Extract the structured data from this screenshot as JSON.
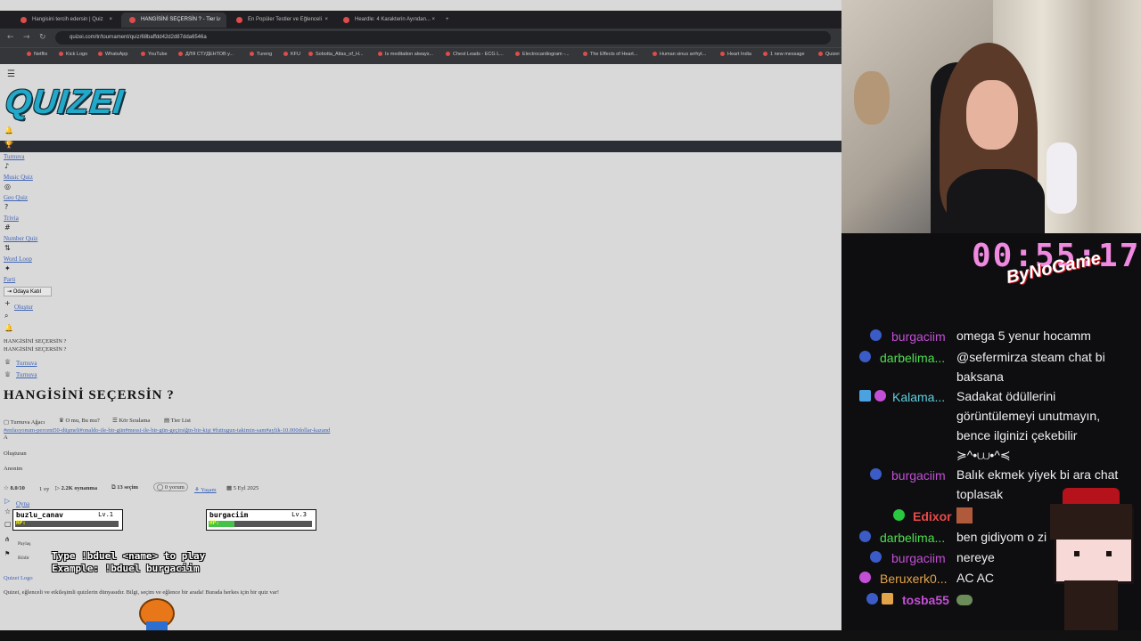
{
  "browser": {
    "tabs": [
      {
        "title": "Hangisini tercih edersin | Quiz"
      },
      {
        "title": "HANGİSİNİ SEÇERSİN ? - Tier L"
      },
      {
        "title": "En Popüler Testler ve Eğlenceli"
      },
      {
        "title": "Heardle: 4 Karakterin Ayından..."
      }
    ],
    "url": "quizei.com/tr/tournament/quiz/68baffdd42d2d87dda6546a",
    "bookmarks": [
      "Netflix",
      "Kick Logo",
      "WhatsApp",
      "YouTube",
      "ДЛЯ СТУДЕНТОВ у...",
      "Tureng",
      "KFU",
      "Sobotta_Atlas_of_H...",
      "Is meditation always...",
      "Chest Leads - ECG L...",
      "Electrocardiogram -...",
      "The Effects of Heart...",
      "Human sinus arrhyt...",
      "Heart India",
      "1 new message",
      "Quizei"
    ]
  },
  "site": {
    "logo": "QUIZEI",
    "nav": [
      "Turnuva",
      "Music Quiz",
      "Geo Quiz",
      "Trivia",
      "Number Quiz",
      "Word Loop",
      "Parti"
    ],
    "join_room": "Odaya Katıl",
    "create": "Oluştur",
    "img_alt_1": "HANGİSİNİ SEÇERSİN ?",
    "img_alt_2": "HANGİSİNİ SEÇERSİN ?",
    "crumb_1": "Turnuva",
    "crumb_2": "Turnuva",
    "title": "HANGİSİNİ SEÇERSİN ?",
    "modes": [
      "Turnuva Ağacı",
      "O mu, Bu mu?",
      "Kör Sıralama",
      "Tier List"
    ],
    "tags": "#enfasyonum-percent50-düşmeli#onaldo-ile-bir-gün#messi-ile-bir-gün-geçirsiğin-bir-kişi #futtugun-takimin-sam#aylik-10.000dollar-kazand",
    "letter": "A",
    "created_by_label": "Oluşturan",
    "author": "Anonim",
    "stats": {
      "rating": "8.0/10",
      "votes": "1 oy",
      "plays": "2.2K oynanma",
      "choices": "13 seçim",
      "comments": "0 yorum",
      "category": "Yaşam",
      "date": "5 Eyl 2025"
    },
    "play": "Oyna",
    "share": "Paylaş",
    "report": "Bildir",
    "footer_logo": "Quizei Logo",
    "footer_text": "Quizei, eğlenceli ve etkileşimli quizlerin dünyasıdır. Bilgi, seçim ve eğlence bir arada! Burada herkes için bir quiz var!"
  },
  "overlay": {
    "players": [
      {
        "name": "buzlu_canav",
        "level": "Lv.1",
        "hp": 0
      },
      {
        "name": "burgaciim",
        "level": "Lv.3",
        "hp": 0.25
      }
    ],
    "hp_label": "HP:",
    "duel_line_1": "Type !bduel <name> to play",
    "duel_line_2": "Example: !bduel burgaciim",
    "timer": "00:55:17",
    "brand": "ByNoGame"
  },
  "chat": [
    {
      "user": "burgaciim",
      "color": "#c34fd6",
      "text": "omega 5 yenur hocamm"
    },
    {
      "user": "darbelima...",
      "color": "#4ee04e",
      "text": "@sefermirza steam chat bi baksana"
    },
    {
      "user": "Kalama...",
      "color": "#5fd0e0",
      "text": "Sadakat ödüllerini görüntülemeyi unutmayın, bence ilginizi çekebilir ≽^•⩊•^≼"
    },
    {
      "user": "burgaciim",
      "color": "#c34fd6",
      "text": "Balık ekmek yiyek bi ara chat toplasak"
    },
    {
      "user": "Edixor",
      "color": "#e84a4a",
      "text": ""
    },
    {
      "user": "darbelima...",
      "color": "#4ee04e",
      "text": "ben gidiyom o zi"
    },
    {
      "user": "burgaciim",
      "color": "#c34fd6",
      "text": "nereye"
    },
    {
      "user": "Beruxerk0...",
      "color": "#e3a34a",
      "text": "AC AC"
    },
    {
      "user": "tosba55",
      "color": "#c34fd6",
      "text": ""
    }
  ]
}
